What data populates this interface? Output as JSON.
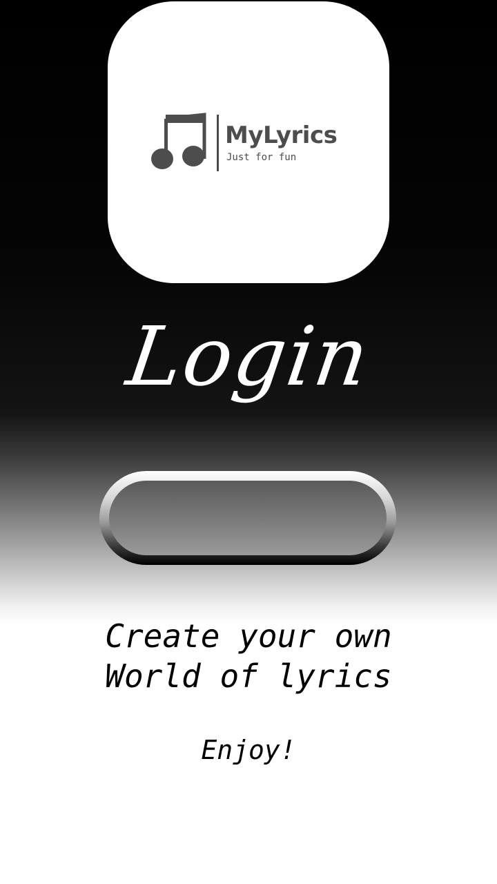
{
  "logo": {
    "name": "MyLyrics",
    "tagline": "Just for fun",
    "icon": "music-note-icon"
  },
  "login": {
    "title": "Login"
  },
  "tagline": {
    "line1": "Create your own",
    "line2": "World of lyrics"
  },
  "footer": {
    "enjoy": "Enjoy!"
  },
  "colors": {
    "background_top": "#000000",
    "background_bottom": "#ffffff",
    "logo_text": "#4d4d4d",
    "title": "#ffffff",
    "text": "#000000"
  }
}
